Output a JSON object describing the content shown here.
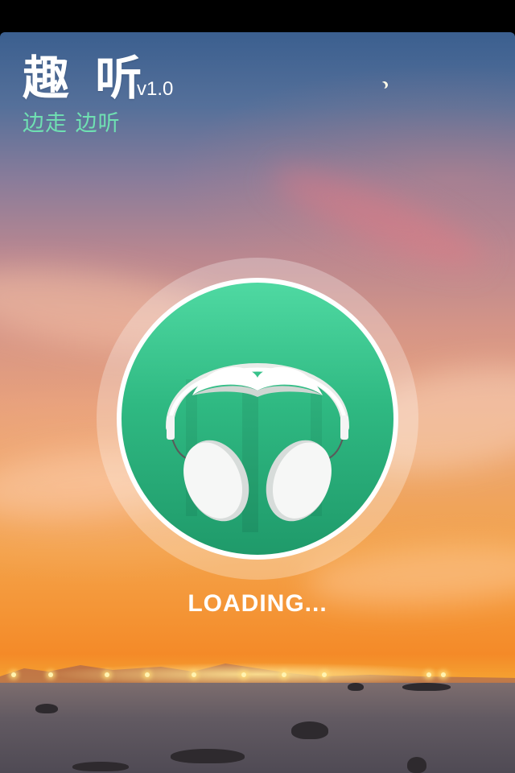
{
  "app": {
    "title": "趣 听",
    "version": "v1.0",
    "slogan": "边走 边听"
  },
  "loading": {
    "label": "LOADING..."
  },
  "logo": {
    "icon": "headphones-icon",
    "disc_color": "#2fb982",
    "ring_color": "#ffffff"
  },
  "colors": {
    "slogan": "#6fe0b2",
    "title": "#ffffff"
  }
}
